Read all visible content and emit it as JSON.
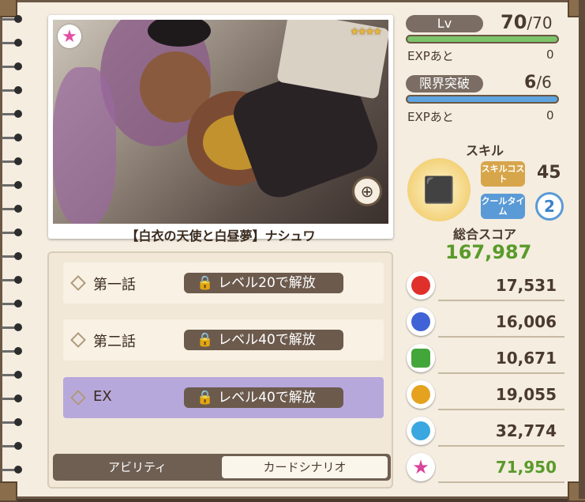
{
  "card": {
    "title": "【白衣の天使と白昼夢】ナシュワ",
    "rarity_stars": "★★★★",
    "type_icon": "pink-star-icon",
    "zoom_icon": "zoom-in-icon"
  },
  "level": {
    "label": "Lv",
    "current": "70",
    "max": "70",
    "progress": 1.0,
    "exp_label": "EXPあと",
    "exp_value": "0",
    "bar_color": "#7cc46a"
  },
  "limit_break": {
    "label": "限界突破",
    "current": "6",
    "max": "6",
    "progress": 1.0,
    "exp_label": "EXPあと",
    "exp_value": "0",
    "bar_color": "#5fa4e0"
  },
  "skill": {
    "title": "スキル",
    "cost_tag": "スキルコスト",
    "cost_value": "45",
    "cooltime_tag": "クールタイム",
    "cooltime_value": "2",
    "icon": "cube-skill-icon"
  },
  "score": {
    "title": "総合スコア",
    "total": "167,987"
  },
  "gems": [
    {
      "icon": "red-gem-icon",
      "color": "#e0302c",
      "value": "17,531"
    },
    {
      "icon": "blue-gem-icon",
      "color": "#3f62d6",
      "value": "16,006"
    },
    {
      "icon": "green-gem-icon",
      "color": "#43a63b",
      "value": "10,671"
    },
    {
      "icon": "yellow-gem-icon",
      "color": "#e5a21f",
      "value": "19,055"
    },
    {
      "icon": "cyan-gem-icon",
      "color": "#3aa7e0",
      "value": "32,774"
    },
    {
      "icon": "star-gem-icon",
      "color": "#d9449c",
      "value": "71,950"
    }
  ],
  "stories": [
    {
      "name": "第一話",
      "lock": "レベル20で解放"
    },
    {
      "name": "第二話",
      "lock": "レベル40で解放"
    },
    {
      "name": "EX",
      "lock": "レベル40で解放"
    }
  ],
  "tabs": {
    "ability": "アビリティ",
    "card_scenario": "カードシナリオ",
    "active": "card_scenario"
  }
}
